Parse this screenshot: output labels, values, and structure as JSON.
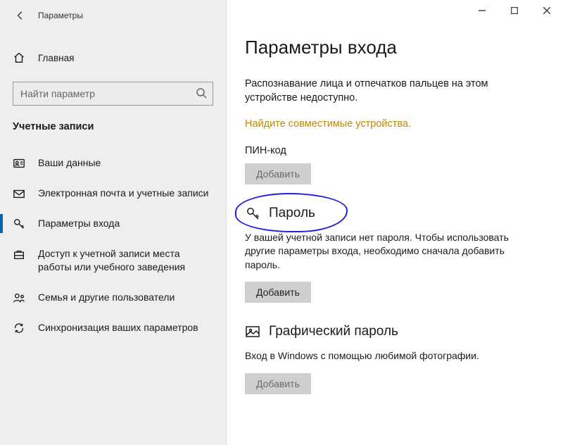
{
  "window": {
    "title": "Параметры"
  },
  "sidebar": {
    "home": "Главная",
    "search_placeholder": "Найти параметр",
    "section": "Учетные записи",
    "items": [
      {
        "label": "Ваши данные"
      },
      {
        "label": "Электронная почта и учетные записи"
      },
      {
        "label": "Параметры входа"
      },
      {
        "label": "Доступ к учетной записи места работы или учебного заведения"
      },
      {
        "label": "Семья и другие пользователи"
      },
      {
        "label": "Синхронизация ваших параметров"
      }
    ]
  },
  "main": {
    "title": "Параметры входа",
    "intro": "Распознавание лица и отпечатков пальцев на этом устройстве недоступно.",
    "link": "Найдите совместимые устройства.",
    "pin": {
      "label": "ПИН-код",
      "button": "Добавить"
    },
    "password": {
      "heading": "Пароль",
      "note": "У вашей учетной записи нет пароля. Чтобы использовать другие параметры входа, необходимо сначала добавить пароль.",
      "button": "Добавить"
    },
    "picture": {
      "heading": "Графический пароль",
      "note": "Вход в Windows с помощью любимой фотографии.",
      "button": "Добавить"
    }
  }
}
